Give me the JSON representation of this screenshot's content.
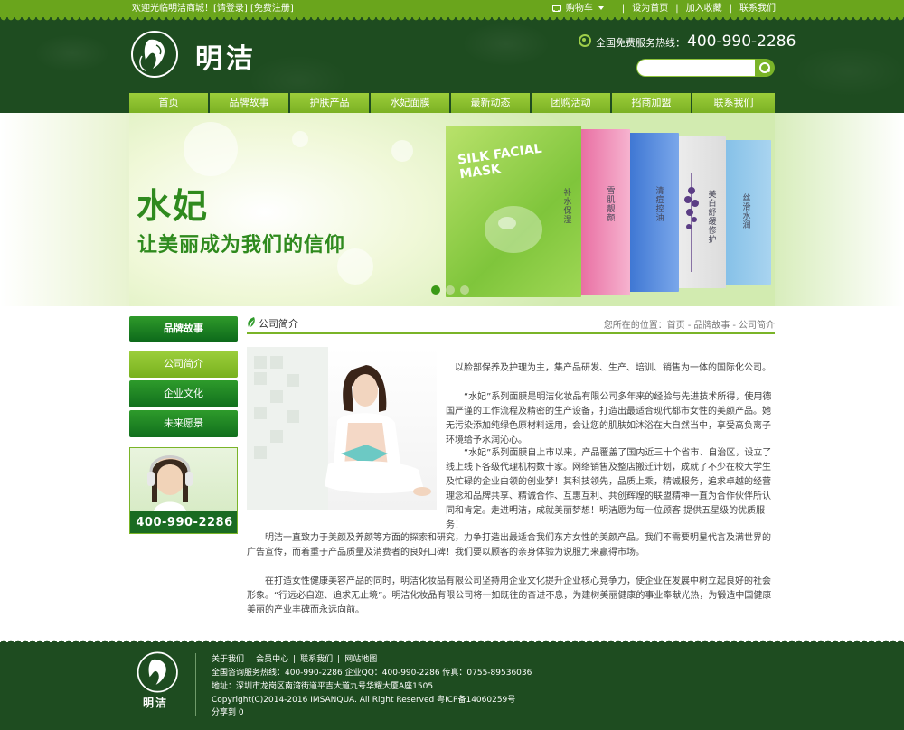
{
  "topbar": {
    "welcome": "欢迎光临明洁商城！",
    "login": "[请登录]",
    "register": "[免费注册]",
    "cart": "购物车",
    "set_home": "设为首页",
    "favorite": "加入收藏",
    "contact": "联系我们",
    "divider": "|"
  },
  "header": {
    "logo_text": "明洁",
    "hotline_label": "全国免费服务热线：",
    "hotline_number": "400-990-2286",
    "search_placeholder": ""
  },
  "nav": [
    "首页",
    "品牌故事",
    "护肤产品",
    "水妃面膜",
    "最新动态",
    "团购活动",
    "招商加盟",
    "联系我们"
  ],
  "banner": {
    "title": "水妃",
    "slogan": "让美丽成为我们的信仰",
    "box_label_1": "SILK FACIAL",
    "box_label_2": "MASK",
    "box_vertical_text": [
      "补水保湿",
      "雪肌靓颜",
      "清痘控油",
      "美白舒缓修护",
      "丝滑水润"
    ],
    "slides_total": 3,
    "slide_active": 1
  },
  "sidebar": {
    "title": "品牌故事",
    "items": [
      "公司简介",
      "企业文化",
      "未来愿景"
    ],
    "active_index": 0,
    "phone": "400-990-2286"
  },
  "content": {
    "section_title": "公司简介",
    "breadcrumb_prefix": "您所在的位置：",
    "breadcrumb": [
      "首页",
      "品牌故事",
      "公司简介"
    ],
    "breadcrumb_sep": "-",
    "paragraphs": [
      "以脸部保养及护理为主，集产品研发、生产、培训、销售为一体的国际化公司。",
      "“水妃”系列面膜是明洁化妆品有限公司多年来的经验与先进技术所得，使用德国严谨的工作流程及精密的生产设备，打造出最适合现代都市女性的美颜产品。她无污染添加纯绿色原材料运用，会让您的肌肤如沐浴在大自然当中，享受高负离子环境给予水润沁心。",
      "“水妃”系列面膜自上市以来，产品覆盖了国内近三十个省市、自治区，设立了线上线下各级代理机构数十家。网络销售及整店搬迁计划，成就了不少在校大学生及忙碌的企业白领的创业梦！其科技领先，品质上乘，精诚服务，追求卓越的经营理念和品牌共享、精诚合作、互惠互利、共创辉煌的联盟精神一直为合作伙伴所认同和肯定。走进明洁，成就美丽梦想！明洁愿为每一位顾客 提供五星级的优质服务！",
      "明洁一直致力于美颜及养颜等方面的探索和研究，力争打造出最适合我们东方女性的美颜产品。我们不需要明星代言及满世界的广告宣传，而着重于产品质量及消费者的良好口碑！我们要以顾客的亲身体验为说服力来赢得市场。",
      "在打造女性健康美容产品的同时，明洁化妆品有限公司坚持用企业文化提升企业核心竞争力，使企业在发展中树立起良好的社会形象。“行远必自迩、追求无止境”。明洁化妆品有限公司将一如既往的奋进不息，为建树美丽健康的事业奉献光热，为锻造中国健康美丽的产业丰碑而永远向前。"
    ]
  },
  "footer": {
    "links": [
      "关于我们",
      "会员中心",
      "联系我们",
      "网站地图"
    ],
    "link_sep": "|",
    "logo_text": "明洁",
    "service_line": "全国咨询服务热线：400-990-2286 企业QQ：400-990-2286 传真：0755-89536036",
    "address": "地址：深圳市龙岗区南湾街道平吉大道九号华耀大厦A座1505",
    "copyright": "Copyright(C)2014-2016 IMSANQUA. All Right Reserved 粤ICP备14060259号",
    "share": "分享到    0"
  },
  "colors": {
    "dark_green": "#1e4c20",
    "light_green": "#6aa51c",
    "nav_green": "#8ec22f",
    "accent_green": "#2f8a1e"
  }
}
